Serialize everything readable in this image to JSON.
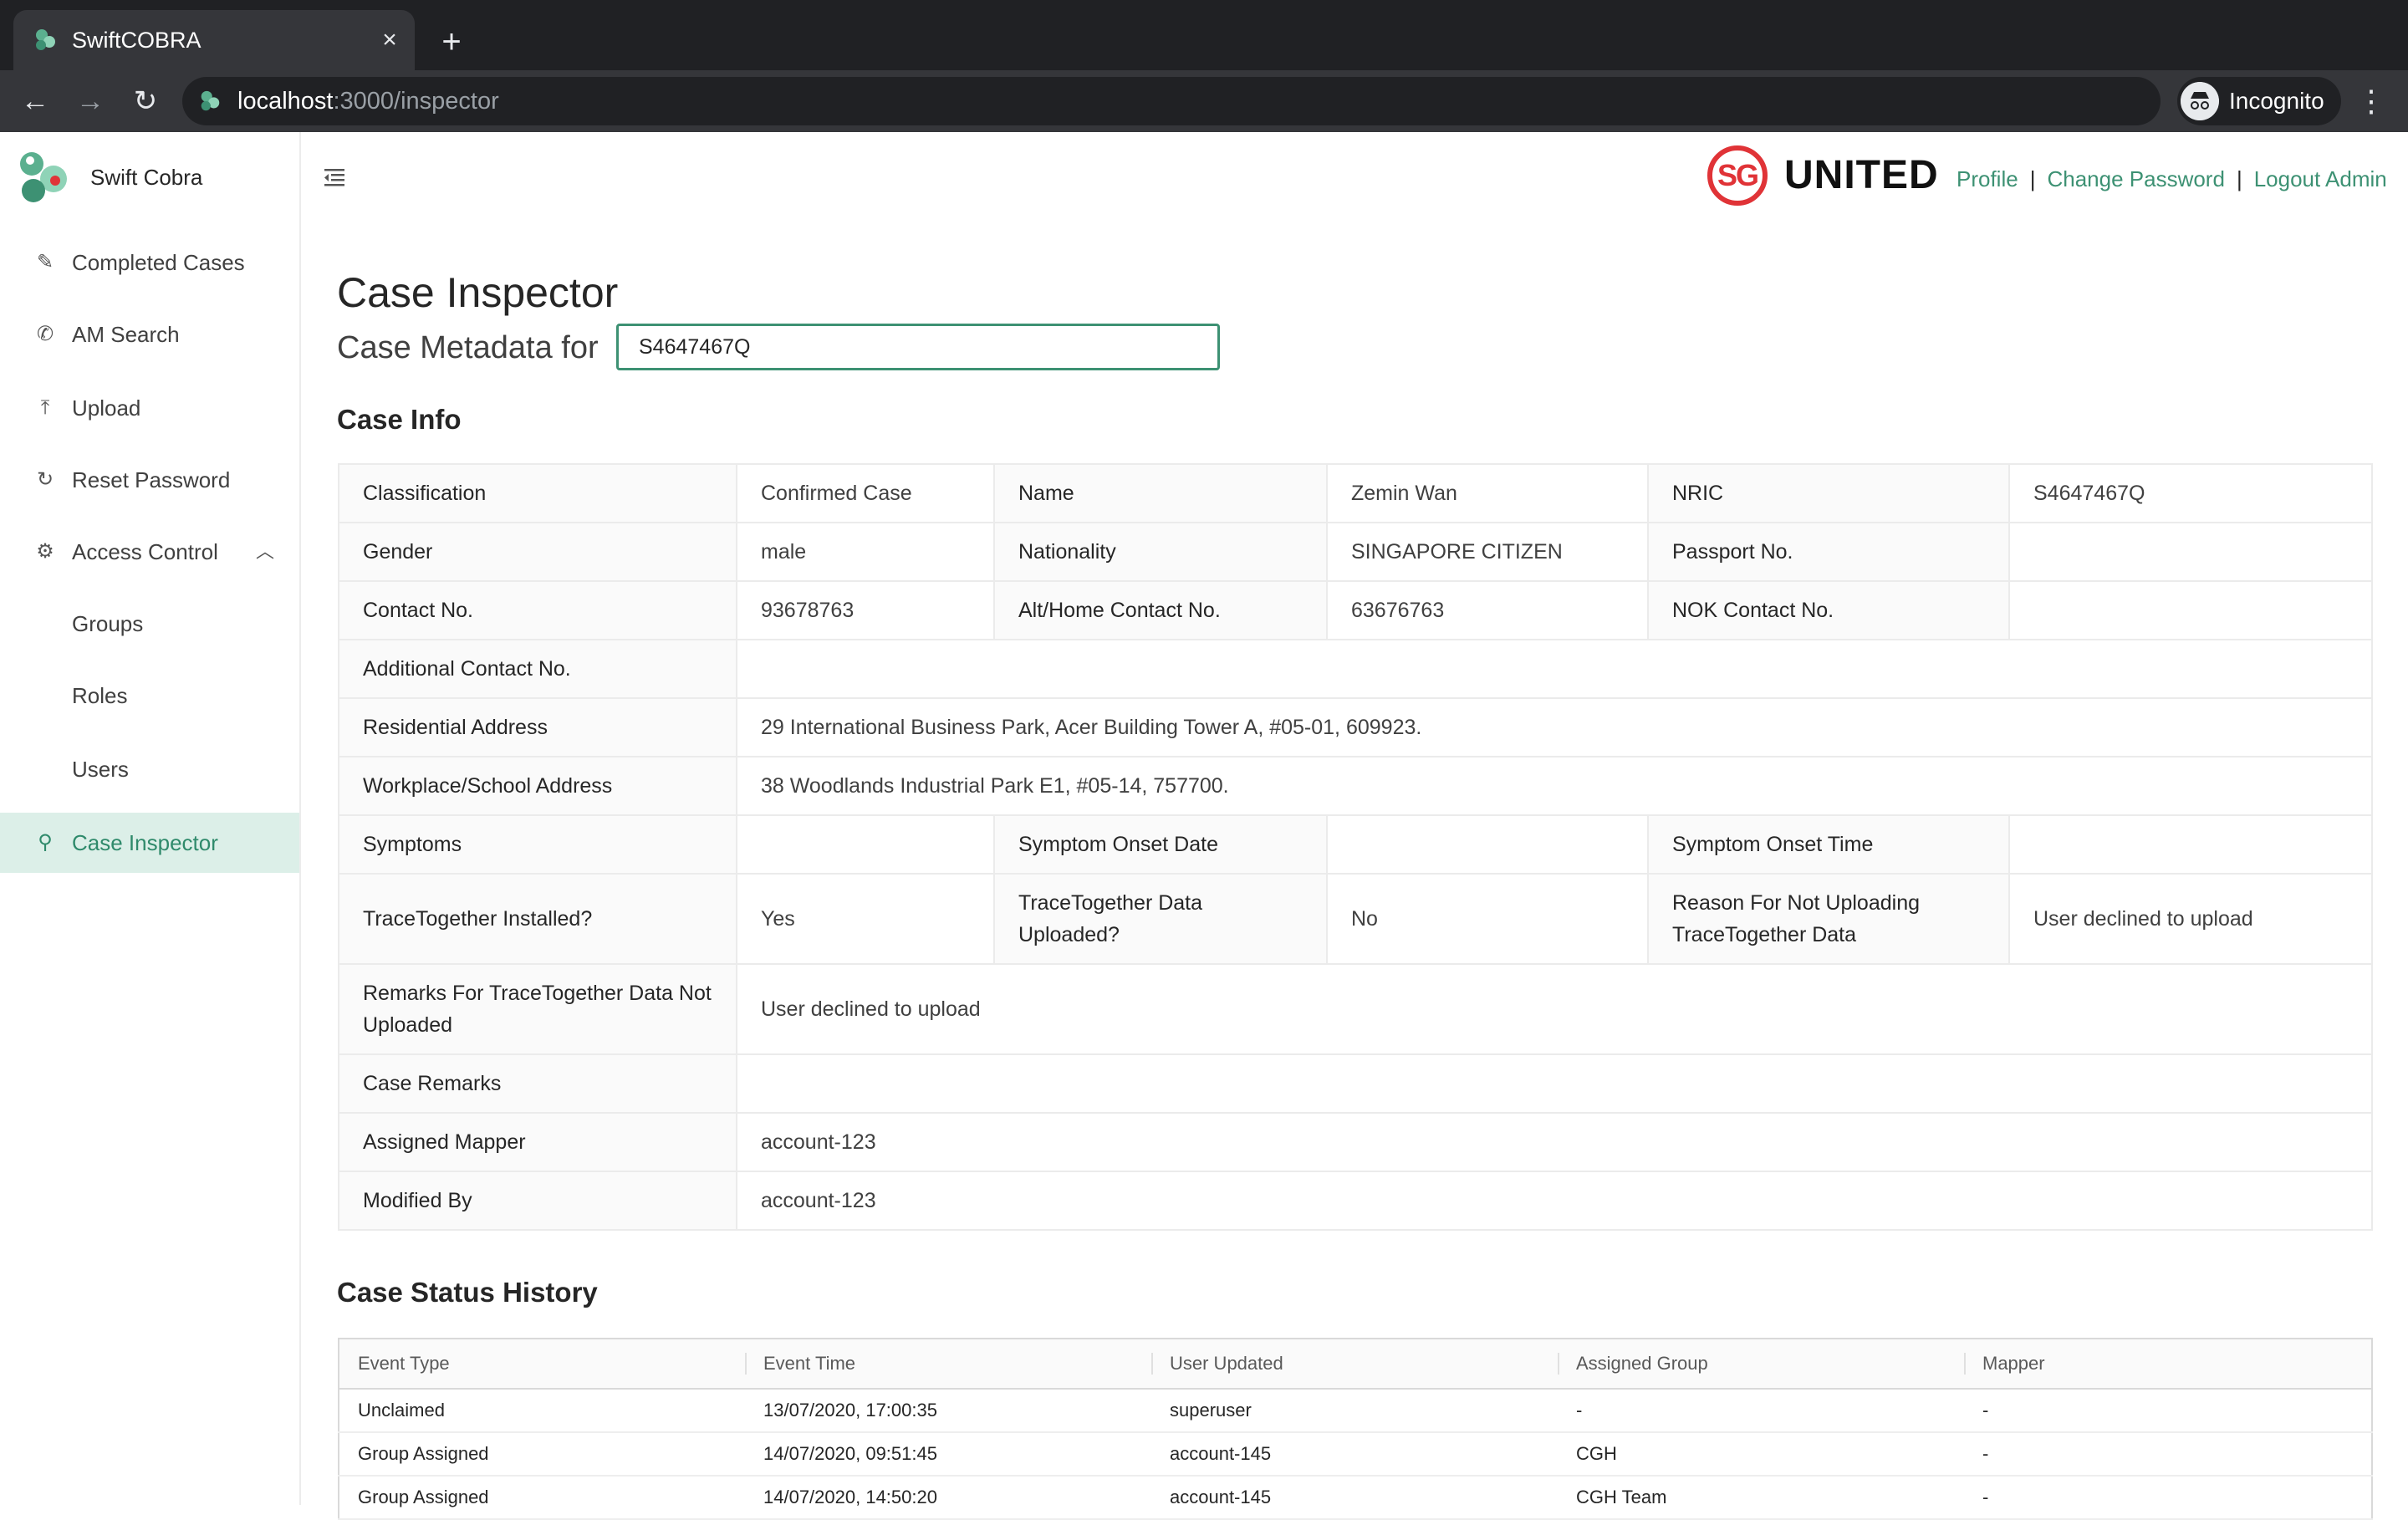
{
  "browser": {
    "tab_title": "SwiftCOBRA",
    "url_host": "localhost",
    "url_path": ":3000/inspector",
    "incognito_label": "Incognito"
  },
  "sidebar": {
    "brand": "Swift Cobra",
    "items": [
      {
        "label": "Completed Cases",
        "icon": "edit-icon"
      },
      {
        "label": "AM Search",
        "icon": "phone-icon"
      },
      {
        "label": "Upload",
        "icon": "upload-icon"
      },
      {
        "label": "Reset Password",
        "icon": "refresh-icon"
      },
      {
        "label": "Access Control",
        "icon": "gear-icon"
      },
      {
        "label": "Groups"
      },
      {
        "label": "Roles"
      },
      {
        "label": "Users"
      },
      {
        "label": "Case Inspector",
        "icon": "search-icon"
      }
    ]
  },
  "header": {
    "logo_sg": "SG",
    "logo_united": "UNITED",
    "links": {
      "profile": "Profile",
      "change_password": "Change Password",
      "logout": "Logout Admin"
    },
    "separator": "|"
  },
  "main": {
    "title": "Case Inspector",
    "metadata_label": "Case Metadata for",
    "case_id_value": "S4647467Q",
    "case_info_title": "Case Info",
    "case_info": {
      "classification_label": "Classification",
      "classification": "Confirmed Case",
      "name_label": "Name",
      "name": "Zemin Wan",
      "nric_label": "NRIC",
      "nric": "S4647467Q",
      "gender_label": "Gender",
      "gender": "male",
      "nationality_label": "Nationality",
      "nationality": "SINGAPORE CITIZEN",
      "passport_label": "Passport No.",
      "passport": "",
      "contact_label": "Contact No.",
      "contact": "93678763",
      "alt_contact_label": "Alt/Home Contact No.",
      "alt_contact": "63676763",
      "nok_label": "NOK Contact No.",
      "nok": "",
      "additional_contact_label": "Additional Contact No.",
      "additional_contact": "",
      "residential_label": "Residential Address",
      "residential": "29 International Business Park, Acer Building Tower A, #05-01, 609923.",
      "workplace_label": "Workplace/School Address",
      "workplace": "38 Woodlands Industrial Park E1, #05-14, 757700.",
      "symptoms_label": "Symptoms",
      "symptoms": "",
      "onset_date_label": "Symptom Onset Date",
      "onset_date": "",
      "onset_time_label": "Symptom Onset Time",
      "onset_time": "",
      "tt_installed_label": "TraceTogether Installed?",
      "tt_installed": "Yes",
      "tt_uploaded_label": "TraceTogether Data Uploaded?",
      "tt_uploaded": "No",
      "tt_reason_label": "Reason For Not Uploading TraceTogether Data",
      "tt_reason": "User declined to upload",
      "tt_remarks_label": "Remarks For TraceTogether Data Not Uploaded",
      "tt_remarks": "User declined to upload",
      "case_remarks_label": "Case Remarks",
      "case_remarks": "",
      "assigned_mapper_label": "Assigned Mapper",
      "assigned_mapper": "account-123",
      "modified_by_label": "Modified By",
      "modified_by": "account-123"
    },
    "history_title": "Case Status History",
    "history": {
      "columns": [
        "Event Type",
        "Event Time",
        "User Updated",
        "Assigned Group",
        "Mapper"
      ],
      "rows": [
        [
          "Unclaimed",
          "13/07/2020, 17:00:35",
          "superuser",
          "-",
          "-"
        ],
        [
          "Group Assigned",
          "14/07/2020, 09:51:45",
          "account-145",
          "CGH",
          "-"
        ],
        [
          "Group Assigned",
          "14/07/2020, 14:50:20",
          "account-145",
          "CGH Team",
          "-"
        ]
      ]
    }
  },
  "colors": {
    "accent": "#3d9173",
    "active_bg": "#dcefe8",
    "brand_red": "#e03337"
  }
}
